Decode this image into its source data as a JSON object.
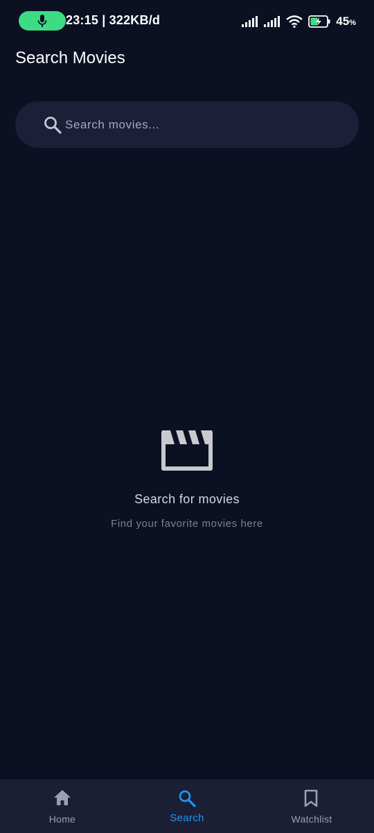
{
  "status_bar": {
    "time_data": "23:15 | 322KB/d",
    "battery": "45",
    "battery_unit": "%",
    "mic_pill_color": "#3ddc84"
  },
  "header": {
    "title": "Search Movies"
  },
  "search": {
    "placeholder": "Search movies...",
    "value": ""
  },
  "empty_state": {
    "icon": "movie-clapper-icon",
    "title": "Search for movies",
    "subtitle": "Find your favorite movies here"
  },
  "bottom_nav": {
    "items": [
      {
        "label": "Home",
        "icon": "home-icon",
        "active": false
      },
      {
        "label": "Search",
        "icon": "search-icon",
        "active": true
      },
      {
        "label": "Watchlist",
        "icon": "bookmark-icon",
        "active": false
      }
    ]
  },
  "colors": {
    "background": "#0b1023",
    "surface": "#1b2038",
    "nav_background": "#1a1f36",
    "accent": "#2196f3",
    "inactive": "#9aa0b2"
  }
}
